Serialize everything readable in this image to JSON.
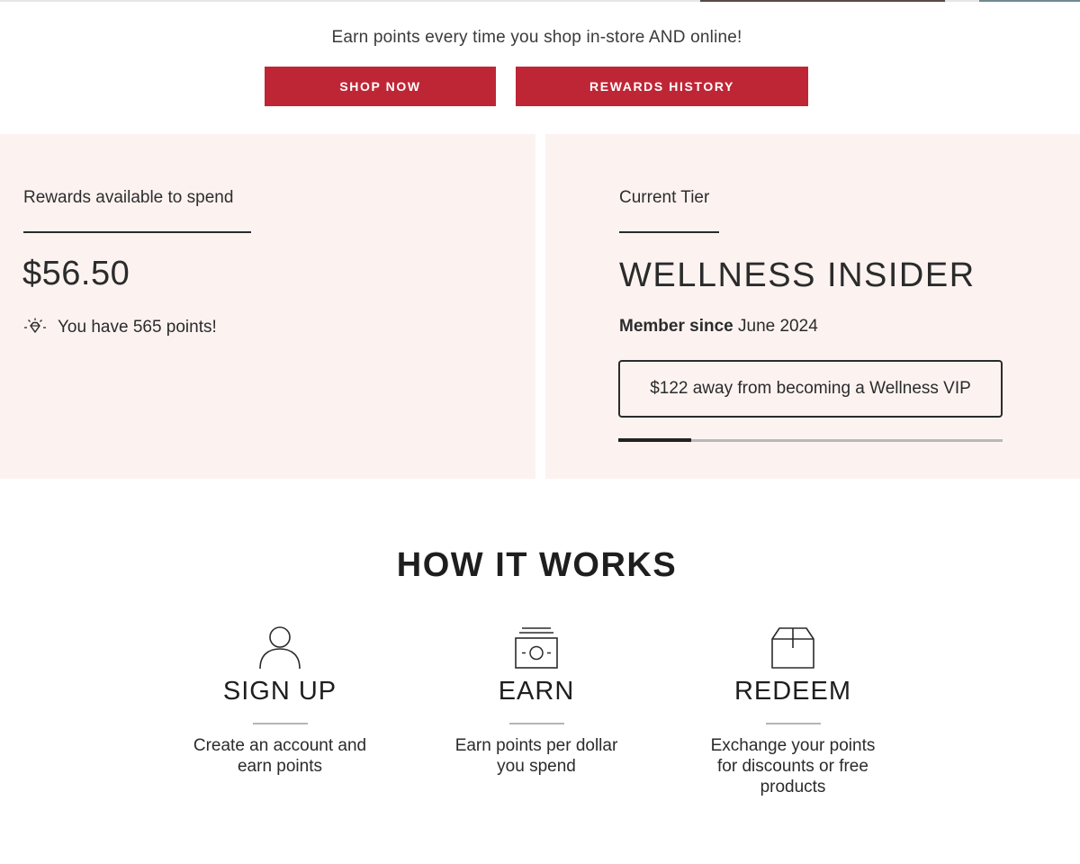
{
  "hero": {
    "tagline": "Earn points every time you shop in-store AND online!",
    "shop_button": "SHOP NOW",
    "history_button": "REWARDS HISTORY"
  },
  "rewards": {
    "label": "Rewards available to spend",
    "amount": "$56.50",
    "points_text": "You have 565 points!",
    "icon": "diamond-icon"
  },
  "tier": {
    "label": "Current Tier",
    "name": "WELLNESS INSIDER",
    "member_since_label": "Member since",
    "member_since_value": "June 2024",
    "next_tier_message": "$122 away from becoming a Wellness VIP",
    "progress_fraction": 0.19
  },
  "how_it_works": {
    "title": "HOW IT WORKS",
    "steps": [
      {
        "icon": "user-icon",
        "title": "SIGN UP",
        "desc": "Create an account and earn points"
      },
      {
        "icon": "money-icon",
        "title": "EARN",
        "desc": "Earn points per dollar you spend"
      },
      {
        "icon": "box-icon",
        "title": "REDEEM",
        "desc": "Exchange your points for discounts or free products"
      }
    ]
  },
  "colors": {
    "accent": "#be2636",
    "panel_bg": "#fcf3f1",
    "text": "#2b2b2b"
  }
}
